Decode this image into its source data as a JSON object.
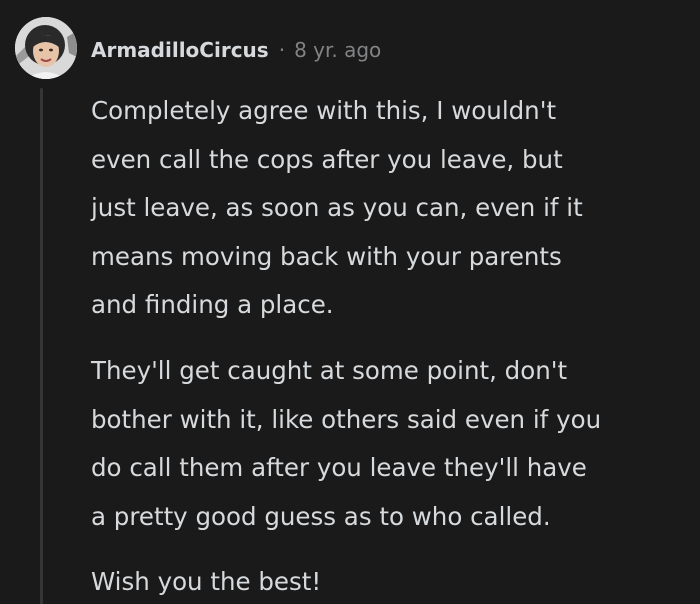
{
  "comment": {
    "author": "ArmadilloCircus",
    "separator": "·",
    "time_ago": "8 yr. ago",
    "avatar_icon": "user-avatar-icon",
    "paragraphs": [
      {
        "lines": [
          "Completely agree with this, I wouldn't",
          "even call the cops after you leave, but",
          "just leave, as soon as you can, even if it",
          "means moving back with your parents",
          "and finding a place."
        ]
      },
      {
        "lines": [
          "They'll get caught at some point, don't",
          "bother with it, like others said even if you",
          "do call them after you leave they'll have",
          "a pretty good guess as to who called."
        ]
      },
      {
        "lines": [
          "Wish you the best!"
        ]
      }
    ]
  },
  "colors": {
    "background": "#1a1a1b",
    "text": "#d7dadc",
    "meta_text": "#818384",
    "thread_line": "#343536"
  }
}
